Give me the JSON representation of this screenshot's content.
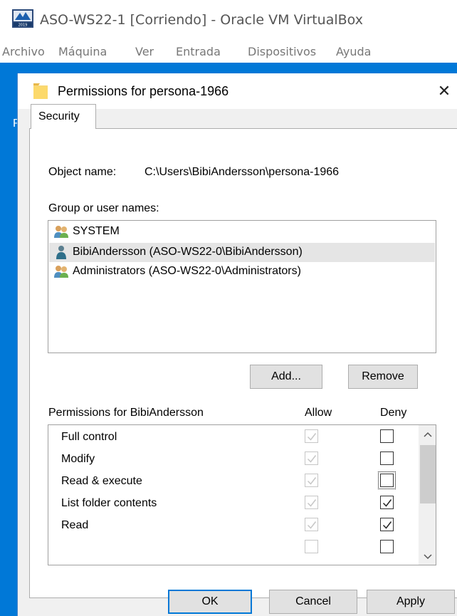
{
  "vbox": {
    "title": "ASO-WS22-1 [Corriendo] - Oracle VM VirtualBox",
    "icon": "virtualbox-server-icon",
    "menu": [
      "Archivo",
      "Máquina",
      "Ver",
      "Entrada",
      "Dispositivos",
      "Ayuda"
    ]
  },
  "guest": {
    "peek_letter": "R"
  },
  "dialog": {
    "title": "Permissions for persona-1966",
    "close_glyph": "✕",
    "tab_label": "Security",
    "object_label": "Object name:",
    "object_path": "C:\\Users\\BibiAndersson\\persona-1966",
    "group_label": "Group or user names:",
    "users": [
      {
        "name": "SYSTEM",
        "icon": "group-users-icon",
        "selected": false
      },
      {
        "name": "BibiAndersson (ASO-WS22-0\\BibiAndersson)",
        "icon": "user-icon",
        "selected": true
      },
      {
        "name": "Administrators (ASO-WS22-0\\Administrators)",
        "icon": "group-users-icon",
        "selected": false
      }
    ],
    "add_label": "Add...",
    "remove_label": "Remove",
    "permissions_header": "Permissions for BibiAndersson",
    "allow_header": "Allow",
    "deny_header": "Deny",
    "permissions": [
      {
        "name": "Full control",
        "allow": true,
        "allow_disabled": true,
        "deny": false
      },
      {
        "name": "Modify",
        "allow": true,
        "allow_disabled": true,
        "deny": false
      },
      {
        "name": "Read & execute",
        "allow": true,
        "allow_disabled": true,
        "deny": false,
        "focused": true
      },
      {
        "name": "List folder contents",
        "allow": true,
        "allow_disabled": true,
        "deny": true
      },
      {
        "name": "Read",
        "allow": true,
        "allow_disabled": true,
        "deny": true
      }
    ],
    "ok_label": "OK",
    "cancel_label": "Cancel",
    "apply_label": "Apply"
  },
  "colors": {
    "desktop_blue": "#0078d7",
    "dialog_bg": "#f0f0f0",
    "selection": "#e5e5e5",
    "disabled_check": "#c6c6c6"
  }
}
